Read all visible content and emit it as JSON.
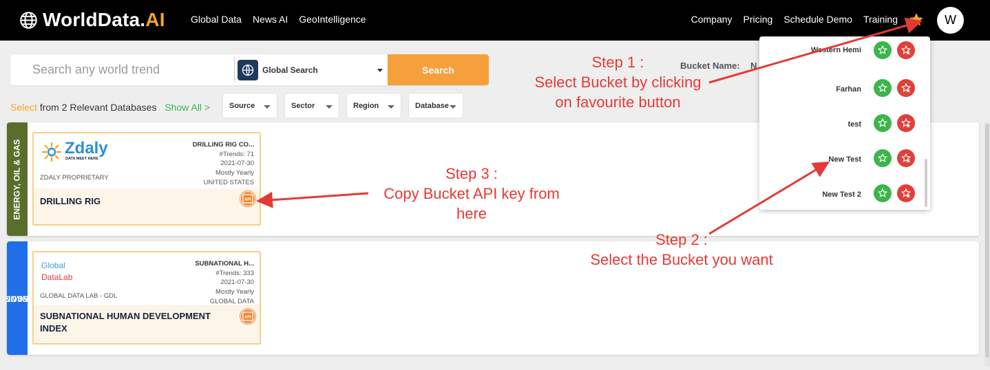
{
  "brand": {
    "name": "WorldData.",
    "suffix": "AI",
    "accent": "#f5a623"
  },
  "nav": {
    "left": [
      "Global Data",
      "News AI",
      "GeoIntelligence"
    ],
    "right": [
      "Company",
      "Pricing",
      "Schedule Demo",
      "Training"
    ],
    "avatar_initial": "W",
    "favorite_icon": "star-icon"
  },
  "search": {
    "placeholder": "Search any world trend",
    "scope_label": "Global Search",
    "button_label": "Search",
    "button_color": "#f5a03a"
  },
  "bucket": {
    "label": "Bucket Name:",
    "value": "N"
  },
  "filters": {
    "select_word": "Select",
    "summary": "from 2 Relevant Databases",
    "show_all": "Show All >",
    "dropdowns": [
      "Source",
      "Sector",
      "Region",
      "Database"
    ]
  },
  "rows": [
    {
      "category": "ENERGY, OIL & GAS",
      "tab_color": "#5a6e2c",
      "card": {
        "logo_main": "Zdaly",
        "logo_sub": "DATA MEET HERE",
        "meta_title": "DRILLING RIG CO...",
        "trends": "#Trends: 71",
        "date": "2021-07-30",
        "frequency": "Mostly Yearly",
        "region": "UNITED STATES",
        "provider": "ZDALY PROPRIETARY",
        "title": "DRILLING RIG"
      }
    },
    {
      "category_line1": "FINANCE",
      "category_line2": "MACROECONOMICS,",
      "tab_color": "#1e6fe8",
      "card": {
        "logo_main_1": "Global",
        "logo_main_2": "DataLab",
        "meta_title": "SUBNATIONAL H...",
        "trends": "#Trends: 333",
        "date": "2021-07-30",
        "frequency": "Mostly Yearly",
        "region": "GLOBAL DATA",
        "provider": "GLOBAL DATA LAB - GDL",
        "title": "SUBNATIONAL HUMAN DEVELOPMENT INDEX"
      }
    }
  ],
  "buckets": [
    "Western Hemi",
    "Farhan",
    "test",
    "New Test",
    "New Test 2"
  ],
  "annotations": {
    "step1": [
      "Step 1 :",
      "Select Bucket by clicking",
      "on favourite button"
    ],
    "step2": [
      "Step 2 :",
      "Select the Bucket you want"
    ],
    "step3": [
      "Step 3 :",
      "Copy Bucket API key from",
      "here"
    ],
    "color": "#e53935"
  }
}
